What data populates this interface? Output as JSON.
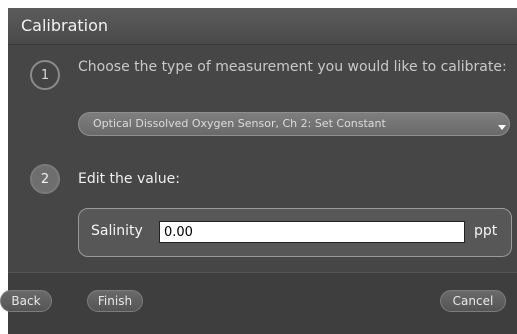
{
  "dialog": {
    "title": "Calibration"
  },
  "steps": [
    {
      "number": "1",
      "text": "Choose the type of measurement you would like to calibrate:",
      "selection": "Optical Dissolved Oxygen Sensor, Ch 2: Set Constant"
    },
    {
      "number": "2",
      "text": "Edit the value:"
    }
  ],
  "value_field": {
    "label": "Salinity",
    "value": "0.00",
    "unit": "ppt"
  },
  "footer": {
    "back_label": "Back",
    "finish_label": "Finish",
    "cancel_label": "Cancel"
  },
  "icons": {
    "dropdown": "chevron-down-icon"
  }
}
